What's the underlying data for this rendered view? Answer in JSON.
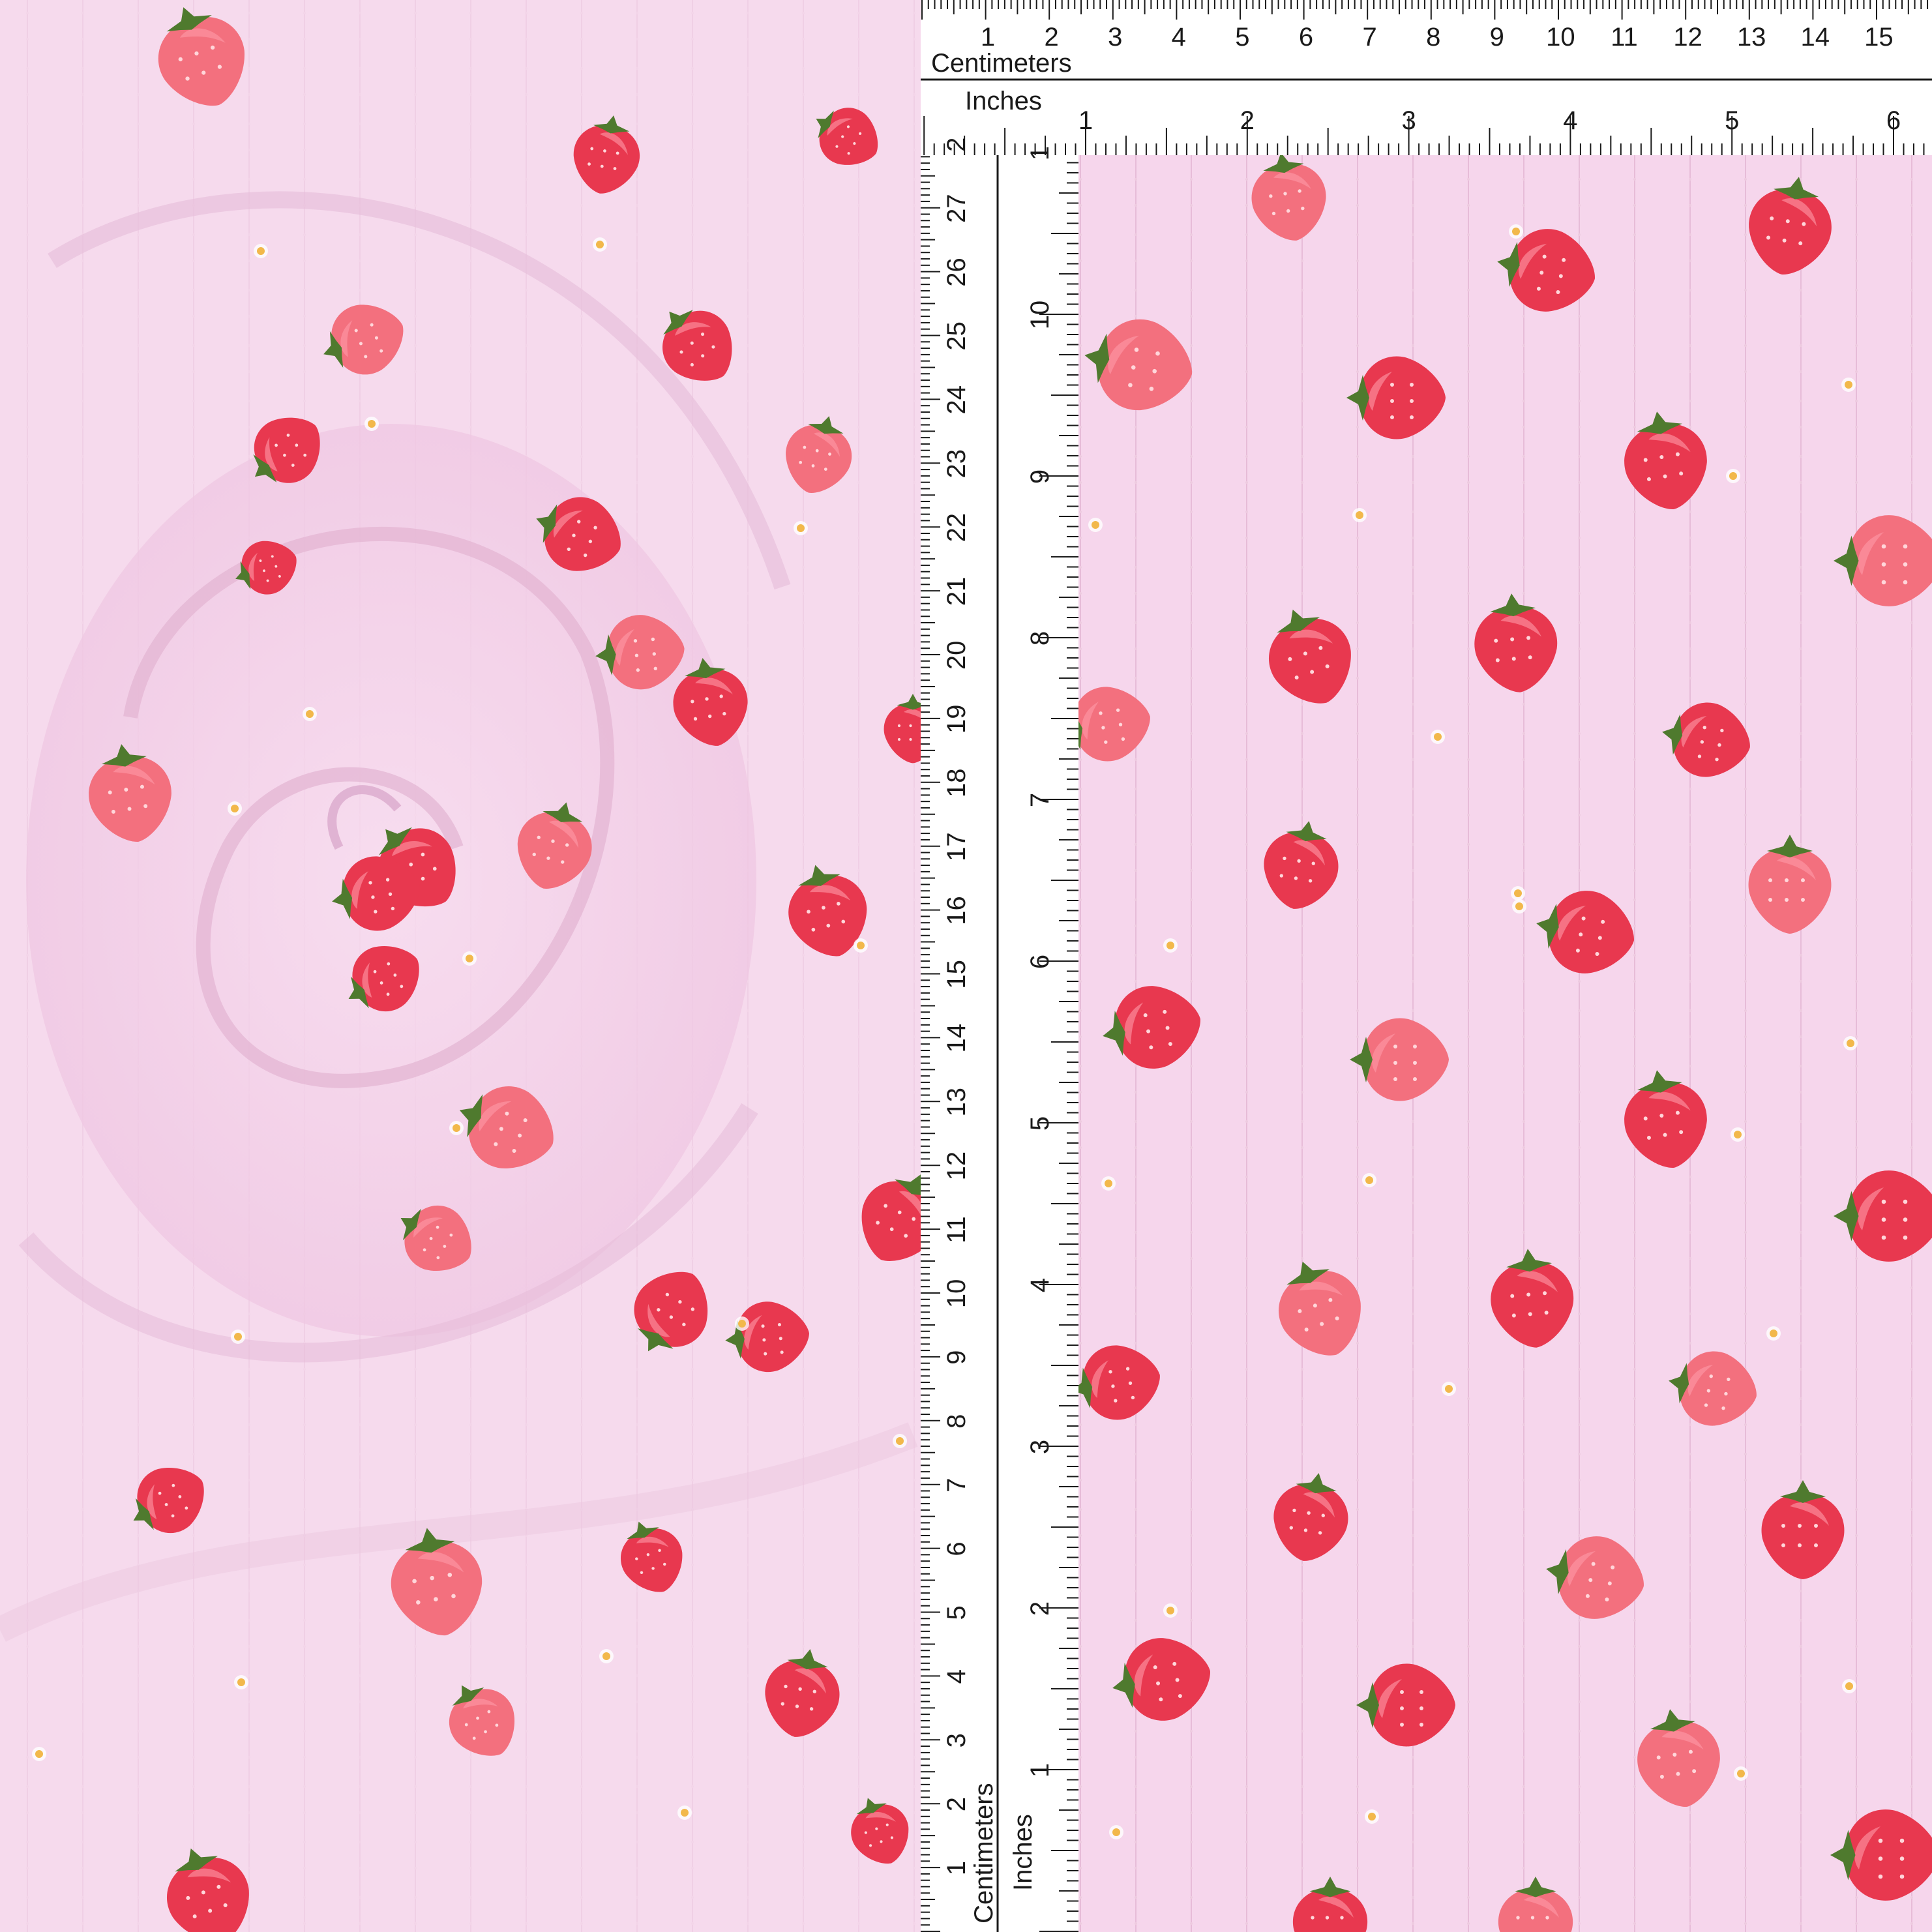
{
  "image": {
    "subject": "strawberry-print-pointelle-knit-fabric-with-ruler",
    "colors": {
      "fabric": "#f6d6ec",
      "strawberry": "#e8384f",
      "strawberry_light": "#f3707e",
      "leaf": "#4f7a2e",
      "flower": "#f2b84b",
      "ruler": "#ffffff",
      "ruler_ink": "#1a1a1a"
    }
  },
  "ruler": {
    "top": {
      "cm_label": "Centimeters",
      "in_label": "Inches",
      "cm_numbers": [
        "1",
        "2",
        "3",
        "4",
        "5",
        "6",
        "7",
        "8",
        "9",
        "10",
        "11",
        "12",
        "13",
        "14",
        "15"
      ],
      "in_numbers": [
        "1",
        "2",
        "3",
        "4",
        "5",
        "6"
      ]
    },
    "left": {
      "cm_label": "Centimeters",
      "in_label": "Inches",
      "cm_numbers": [
        "1",
        "2",
        "3",
        "4",
        "5",
        "6",
        "7",
        "8",
        "9",
        "10",
        "11",
        "12",
        "13",
        "14",
        "15",
        "16",
        "17",
        "18",
        "19",
        "20",
        "21",
        "22",
        "23",
        "24",
        "25",
        "26",
        "27",
        "2"
      ],
      "in_numbers": [
        "1",
        "2",
        "3",
        "4",
        "5",
        "6",
        "7",
        "8",
        "9",
        "10",
        "1"
      ]
    }
  }
}
